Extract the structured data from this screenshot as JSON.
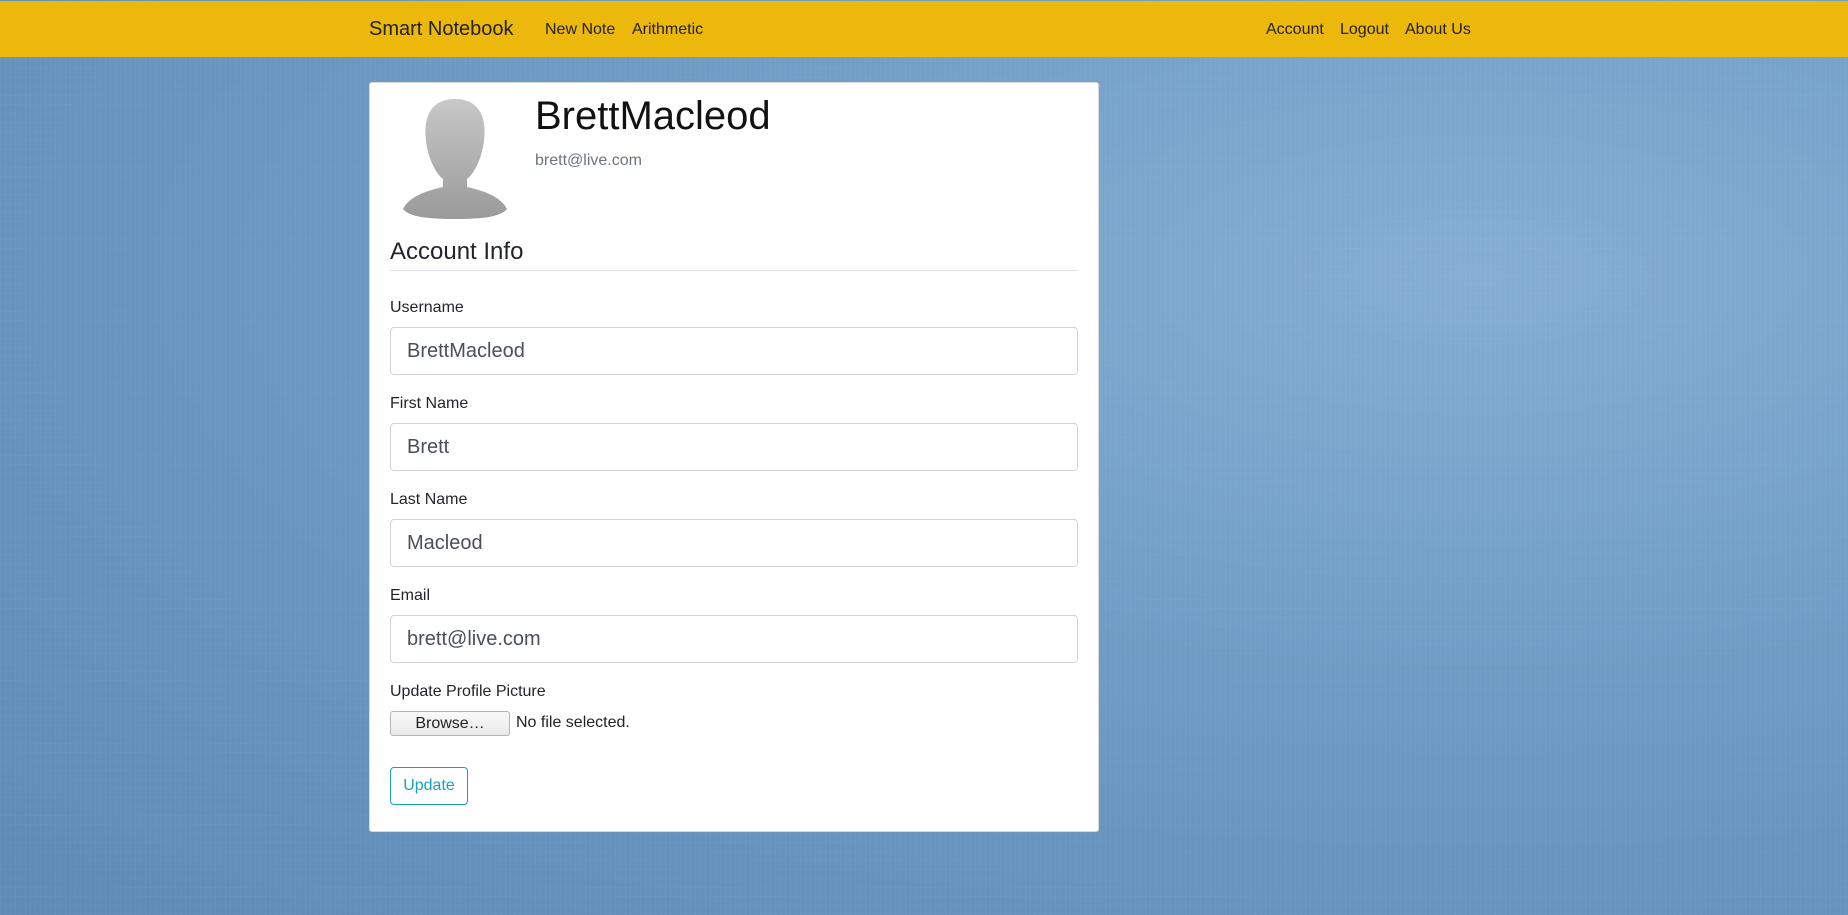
{
  "navbar": {
    "brand": "Smart Notebook",
    "left_links": [
      "New Note",
      "Arithmetic"
    ],
    "right_links": [
      "Account",
      "Logout",
      "About Us"
    ],
    "background_color": "#ebb80b"
  },
  "profile": {
    "name": "BrettMacleod",
    "email": "brett@live.com",
    "avatar_icon": "default-user-silhouette-icon"
  },
  "account_info": {
    "title": "Account Info",
    "fields": [
      {
        "label": "Username",
        "value": "BrettMacleod"
      },
      {
        "label": "First Name",
        "value": "Brett"
      },
      {
        "label": "Last Name",
        "value": "Macleod"
      },
      {
        "label": "Email",
        "value": "brett@live.com"
      }
    ],
    "picture": {
      "label": "Update Profile Picture",
      "browse_label": "Browse…",
      "status": "No file selected."
    },
    "update_label": "Update",
    "accent_color": "#17a2b8"
  }
}
